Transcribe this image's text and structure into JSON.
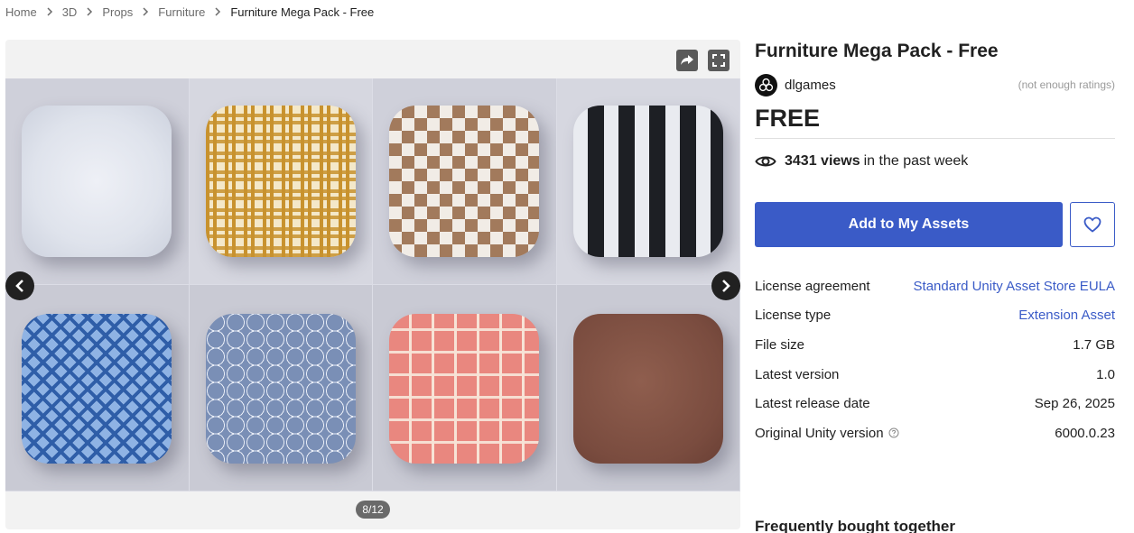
{
  "breadcrumb": {
    "items": [
      "Home",
      "3D",
      "Props",
      "Furniture"
    ],
    "current": "Furniture Mega Pack - Free"
  },
  "gallery": {
    "counter": "8/12"
  },
  "product": {
    "title": "Furniture Mega Pack - Free",
    "publisher": "dlgames",
    "rating_text": "(not enough ratings)",
    "price": "FREE",
    "views_count": "3431 views",
    "views_suffix": "in the past week",
    "add_button": "Add to My Assets"
  },
  "info": [
    {
      "key": "License agreement",
      "value": "Standard Unity Asset Store EULA"
    },
    {
      "key": "License type",
      "value": "Extension Asset"
    },
    {
      "key": "File size",
      "value": "1.7 GB"
    },
    {
      "key": "Latest version",
      "value": "1.0"
    },
    {
      "key": "Latest release date",
      "value": "Sep 26, 2025"
    },
    {
      "key": "Original Unity version",
      "value": "6000.0.23"
    }
  ],
  "section_heading": "Frequently bought together",
  "colors": {
    "accent": "#3a5bc7",
    "text": "#212121",
    "muted": "#6b6b6b"
  },
  "icons": [
    "chevron-right-icon",
    "share-icon",
    "fullscreen-icon",
    "chevron-left-icon",
    "eye-icon",
    "heart-icon",
    "help-icon"
  ]
}
